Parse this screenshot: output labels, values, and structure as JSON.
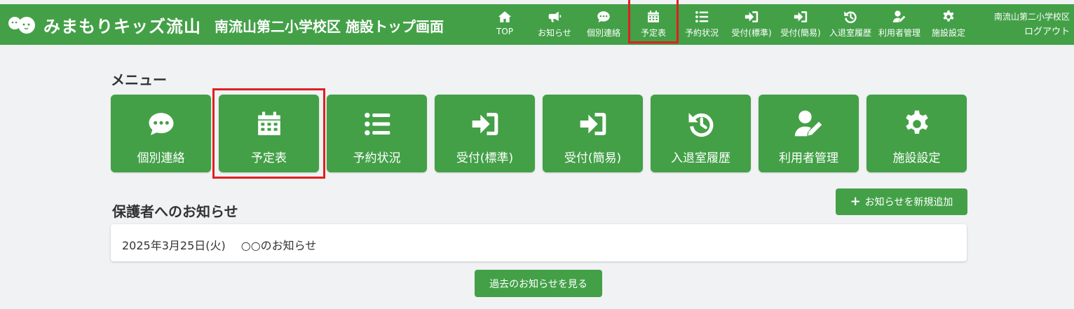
{
  "header": {
    "logo_text": "みまもりキッズ流山",
    "page_title": "南流山第二小学校区 施設トップ画面",
    "nav": [
      {
        "label": "TOP",
        "icon": "home-icon"
      },
      {
        "label": "お知らせ",
        "icon": "megaphone-icon"
      },
      {
        "label": "個別連絡",
        "icon": "chat-icon"
      },
      {
        "label": "予定表",
        "icon": "calendar-icon"
      },
      {
        "label": "予約状況",
        "icon": "list-icon"
      },
      {
        "label": "受付(標準)",
        "icon": "sign-in-icon"
      },
      {
        "label": "受付(簡易)",
        "icon": "sign-in-icon"
      },
      {
        "label": "入退室履歴",
        "icon": "history-icon"
      },
      {
        "label": "利用者管理",
        "icon": "user-edit-icon"
      },
      {
        "label": "施設設定",
        "icon": "gear-icon"
      }
    ],
    "user_name": "南流山第二小学校区",
    "logout_label": "ログアウト"
  },
  "menu": {
    "title": "メニュー",
    "tiles": [
      {
        "label": "個別連絡",
        "icon": "chat-icon"
      },
      {
        "label": "予定表",
        "icon": "calendar-icon"
      },
      {
        "label": "予約状況",
        "icon": "list-icon"
      },
      {
        "label": "受付(標準)",
        "icon": "sign-in-icon"
      },
      {
        "label": "受付(簡易)",
        "icon": "sign-in-icon"
      },
      {
        "label": "入退室履歴",
        "icon": "history-icon"
      },
      {
        "label": "利用者管理",
        "icon": "user-edit-icon"
      },
      {
        "label": "施設設定",
        "icon": "gear-icon"
      }
    ]
  },
  "notices": {
    "title": "保護者へのお知らせ",
    "add_button_label": "お知らせを新規追加",
    "items": [
      {
        "date": "2025年3月25日(火)",
        "text": "○○のお知らせ"
      }
    ],
    "past_button_label": "過去のお知らせを見る"
  },
  "colors": {
    "brand_green": "#43a047",
    "highlight_red": "#e02020",
    "background": "#f1f2f4"
  }
}
